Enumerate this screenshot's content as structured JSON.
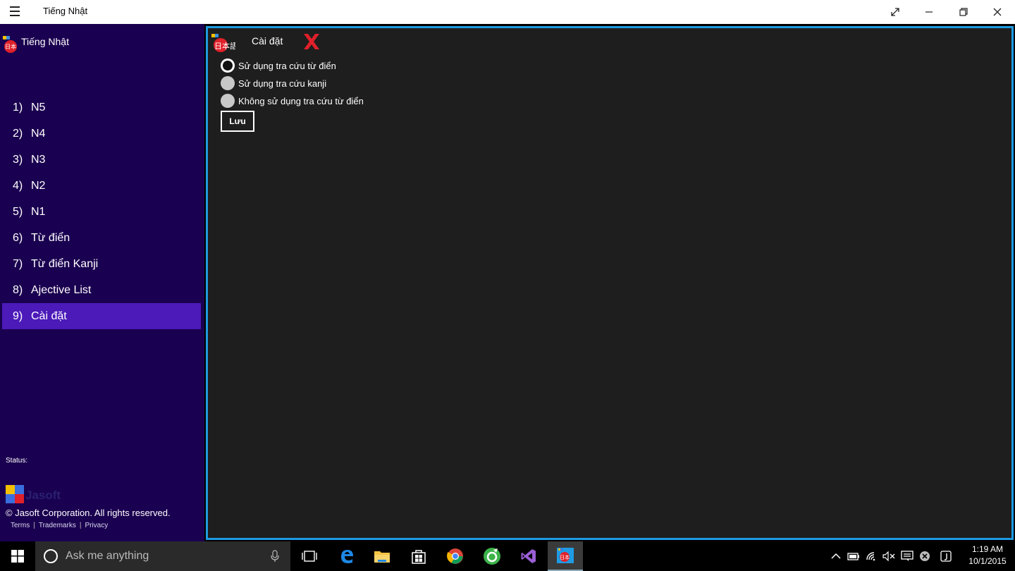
{
  "window": {
    "title": "Tiếng Nhật"
  },
  "sidebar": {
    "title": "Tiếng Nhật",
    "items": [
      {
        "num": "1)",
        "label": "N5"
      },
      {
        "num": "2)",
        "label": "N4"
      },
      {
        "num": "3)",
        "label": "N3"
      },
      {
        "num": "4)",
        "label": "N2"
      },
      {
        "num": "5)",
        "label": "N1"
      },
      {
        "num": "6)",
        "label": "Từ điển"
      },
      {
        "num": "7)",
        "label": "Từ điển Kanji"
      },
      {
        "num": "8)",
        "label": "Ajective List"
      },
      {
        "num": "9)",
        "label": "Cài đặt",
        "selected": true
      }
    ],
    "status_label": "Status:",
    "brand_logo": "Jasoft",
    "copyright": "© Jasoft Corporation. All rights reserved.",
    "links": [
      "Terms",
      "Trademarks",
      "Privacy"
    ]
  },
  "content": {
    "logo_text": "日本語",
    "title": "Cài đặt",
    "options": [
      {
        "label": "Sử dụng tra cứu từ điển",
        "checked": true
      },
      {
        "label": "Sử dụng tra cứu kanji",
        "checked": false
      },
      {
        "label": "Không sử dụng tra cứu từ điển",
        "checked": false
      }
    ],
    "save_label": "Lưu"
  },
  "taskbar": {
    "search_placeholder": "Ask me anything",
    "apps": [
      "task-view-icon",
      "edge-icon",
      "file-explorer-icon",
      "store-icon",
      "chrome-icon",
      "app-green-icon",
      "visual-studio-icon",
      "tieng-nhat-app-icon"
    ],
    "time": "1:19 AM",
    "date": "10/1/2015"
  },
  "colors": {
    "sidebar_bg": "#1a0050",
    "selected_bg": "#4b1ab9",
    "content_bg": "#1e1e1e",
    "content_border": "#1e9be3",
    "accent_red": "#e0202a"
  }
}
